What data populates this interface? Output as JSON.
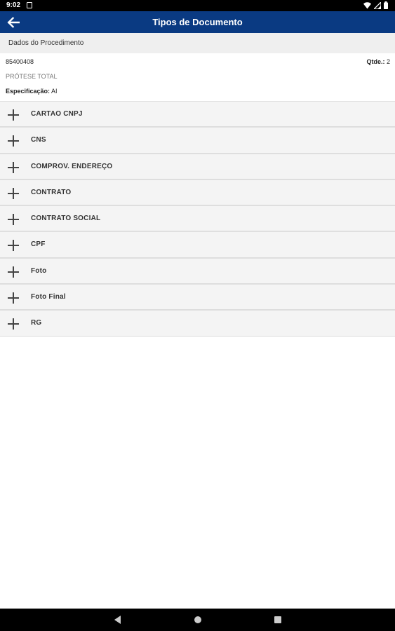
{
  "status_bar": {
    "time": "9:02"
  },
  "app_bar": {
    "title": "Tipos de Documento"
  },
  "section": {
    "title": "Dados do Procedimento"
  },
  "procedure": {
    "code": "85400408",
    "qty_label": "Qtde.:",
    "qty_value": "2",
    "name": "PRÓTESE TOTAL",
    "spec_label": "Especificação:",
    "spec_value": "AI"
  },
  "documents": [
    {
      "label": "CARTAO CNPJ",
      "icon": "plus-icon"
    },
    {
      "label": "CNS",
      "icon": "plus-icon"
    },
    {
      "label": "COMPROV. ENDEREÇO",
      "icon": "plus-icon"
    },
    {
      "label": "CONTRATO",
      "icon": "plus-icon"
    },
    {
      "label": "CONTRATO SOCIAL",
      "icon": "plus-icon"
    },
    {
      "label": "CPF",
      "icon": "plus-icon"
    },
    {
      "label": "Foto",
      "icon": "plus-icon"
    },
    {
      "label": "Foto Final",
      "icon": "plus-icon"
    },
    {
      "label": "RG",
      "icon": "plus-icon"
    }
  ],
  "colors": {
    "app_bar": "#0a3a82",
    "section_bg": "#efefef",
    "item_bg": "#f4f4f4"
  }
}
